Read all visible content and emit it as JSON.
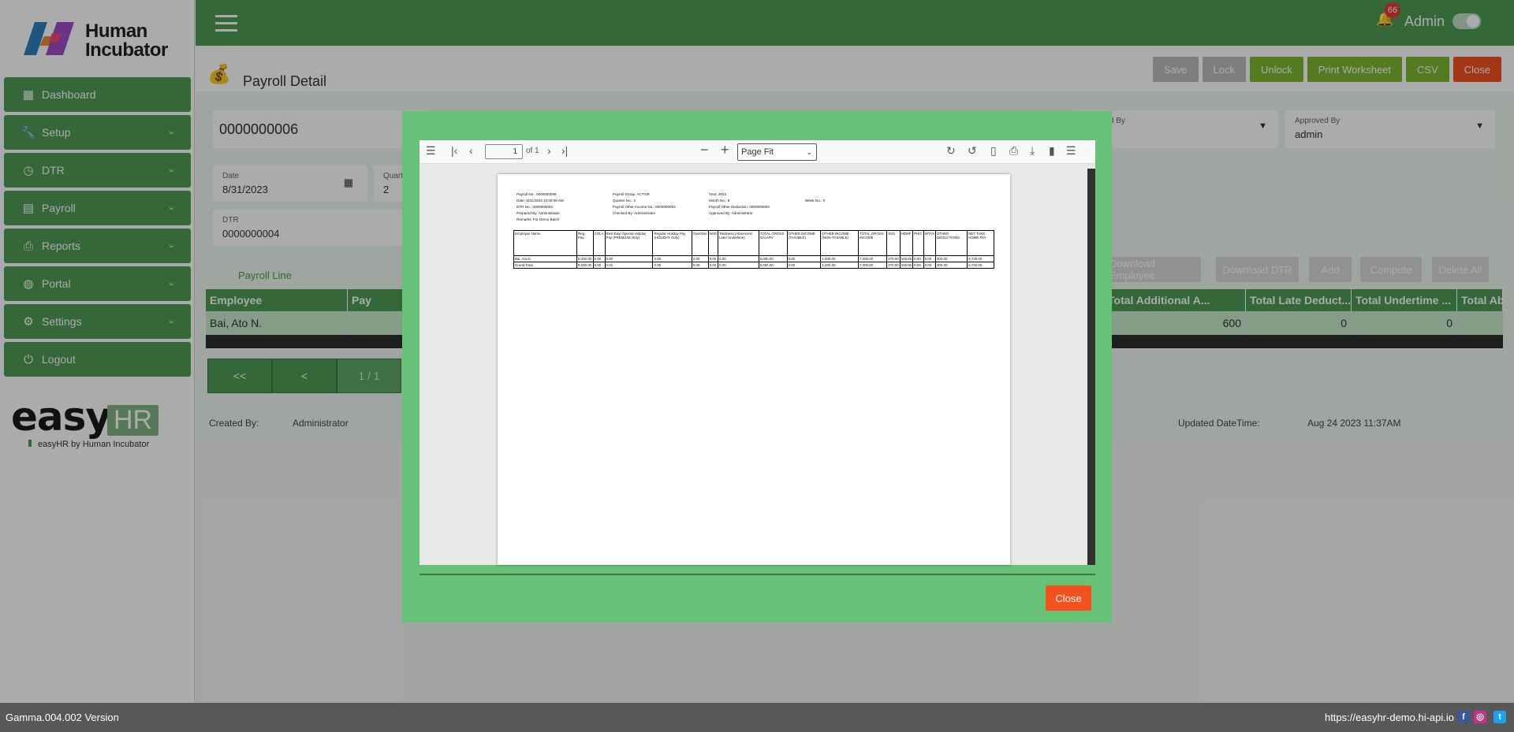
{
  "brand": {
    "logo_line1": "Human",
    "logo_line2": "Incubator",
    "easy_word": "easy",
    "easy_hr": "HR",
    "easy_sub": "easyHR by Human Incubator"
  },
  "sidebar": {
    "items": [
      {
        "label": "Dashboard",
        "icon": "dashboard-icon"
      },
      {
        "label": "Setup",
        "icon": "wrench-icon"
      },
      {
        "label": "DTR",
        "icon": "clock-icon"
      },
      {
        "label": "Payroll",
        "icon": "money-icon"
      },
      {
        "label": "Reports",
        "icon": "printer-icon"
      },
      {
        "label": "Portal",
        "icon": "globe-icon"
      },
      {
        "label": "Settings",
        "icon": "gear-icon"
      },
      {
        "label": "Logout",
        "icon": "power-icon"
      }
    ]
  },
  "topbar": {
    "notifications": "66",
    "user": "Admin"
  },
  "page": {
    "title": "Payroll Detail",
    "actions": {
      "save": "Save",
      "lock": "Lock",
      "unlock": "Unlock",
      "print": "Print Worksheet",
      "csv": "CSV",
      "close": "Close"
    }
  },
  "form": {
    "payroll_no": "0000000006",
    "date_label": "Date",
    "date_value": "8/31/2023",
    "quarter_label": "Quarter",
    "quarter_value": "2",
    "dtr_label": "DTR",
    "dtr_value": "0000000004",
    "checked_by_label": "Checked By",
    "approved_by_label": "Approved By",
    "approved_by_value": "admin"
  },
  "tabs": {
    "payroll_line": "Payroll Line"
  },
  "line_actions": {
    "download_employee": "Download Employee",
    "download_dtr": "Download DTR",
    "add": "Add",
    "compute": "Compute",
    "delete_all": "Delete All"
  },
  "grid": {
    "headers": {
      "employee": "Employee",
      "pay": "Pay",
      "total_additional": "Total Additional A...",
      "total_late": "Total Late Deduct...",
      "total_undertime": "Total Undertime ...",
      "total_absent": "Total Absent Amo..."
    },
    "row": {
      "employee": "Bai, Ato N.",
      "total_additional": "600",
      "total_late": "0",
      "total_undertime": "0"
    }
  },
  "pager": {
    "first": "<<",
    "prev": "<",
    "page": "1 / 1"
  },
  "meta": {
    "created_by_label": "Created By:",
    "created_by": "Administrator",
    "updated_label": "Updated DateTime:",
    "updated": "Aug 24 2023 11:37AM"
  },
  "viewer": {
    "page_input": "1",
    "of_pages": "of 1",
    "zoom": "Page Fit",
    "report": {
      "col1": [
        "Payroll No.: 0000000006",
        "Date: 8/31/2023 12:00:00 AM",
        "DTR No.: 0000000004",
        "Prepared By: Administrator",
        "Remarks: For Demo Batch"
      ],
      "col2": [
        "Payroll Group: ACTIVE",
        "Quarter No.: 2",
        "Payroll Other Income No.: 0000000003",
        "Checked By: Administrator"
      ],
      "col3": [
        "Year: 2023",
        "Month No.: 8",
        "Payroll Other Deduction: 0000000003",
        "Approved By: Administrator"
      ],
      "col4": [
        "Week No.: 0"
      ],
      "headers": [
        "Employee Name",
        "Reg. Pay",
        "COLA",
        "Rest Day/ Special Holiday Pay (PREMIUM Only)",
        "Regular Holiday Pay (HOLIDAY Only)",
        "Overtime",
        "NSD",
        "Tardiness (Absences/ Late/ Undertime)",
        "TOTAL GROSS SALARY",
        "OTHER INCOME (TAXABLE)",
        "OTHER INCOME (NON-TAXABLE)",
        "TOTAL GROSS INCOME",
        "SSS",
        "HDMF",
        "PHIC",
        "WTAX",
        "OTHER DEDUCTIONS",
        "NET TAKE HOME PAY"
      ],
      "rows": [
        [
          "Bai, Ato N.",
          "5,000.00",
          "0.00",
          "0.00",
          "0.00",
          "0.00",
          "0.00",
          "0.00",
          "5,000.00",
          "0.00",
          "1,000.00",
          "7,000.00",
          "270.00",
          "100.00",
          "0.00",
          "0.00",
          "300.00",
          "6,730.00"
        ],
        [
          "Grand Total",
          "5,000.00",
          "0.00",
          "0.00",
          "0.00",
          "0.00",
          "0.00",
          "0.00",
          "5,000.00",
          "0.00",
          "1,000.00",
          "7,000.00",
          "270.00",
          "100.00",
          "0.00",
          "0.00",
          "300.00",
          "6,730.00"
        ]
      ]
    }
  },
  "modal": {
    "close": "Close"
  },
  "footer": {
    "version": "Gamma.004.002 Version",
    "url": "https://easyhr-demo.hi-api.io"
  },
  "colors": {
    "primary": "#4e9b55",
    "modal": "#67c176",
    "danger": "#f4511e",
    "olive": "#7cb82f"
  }
}
